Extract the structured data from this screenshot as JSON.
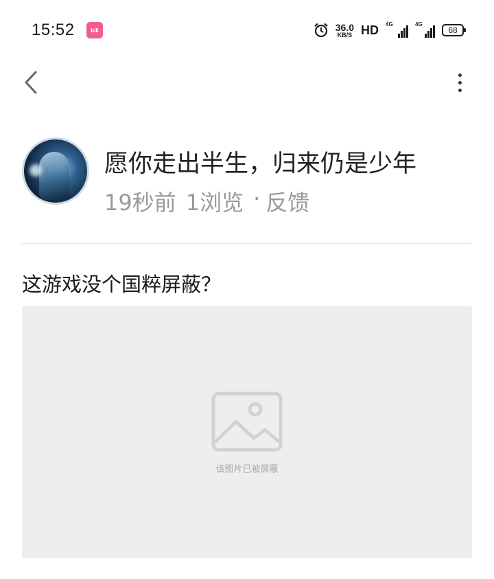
{
  "status_bar": {
    "time": "15:52",
    "app_badge": "bili",
    "net_speed_value": "36.0",
    "net_speed_unit": "KB/S",
    "hd_label": "HD",
    "signal1_label": "4G",
    "signal2_label": "4G",
    "battery": "68",
    "icons": [
      "alarm-icon",
      "signal-icon",
      "battery-icon"
    ]
  },
  "header": {
    "back_icon": "chevron-left-icon",
    "more_icon": "more-vertical-icon"
  },
  "author": {
    "name": "愿你走出半生，归来仍是少年",
    "time": "19秒前",
    "views": "1浏览",
    "separator": "·",
    "feedback": "反馈"
  },
  "post": {
    "text": "这游戏没个国粹屏蔽？",
    "image_caption": "该图片已被屏蔽",
    "image_icon": "image-placeholder-icon"
  },
  "colors": {
    "badge": "#f25d8e",
    "meta_text": "#9a9a9a",
    "image_bg": "#eeeeee"
  }
}
